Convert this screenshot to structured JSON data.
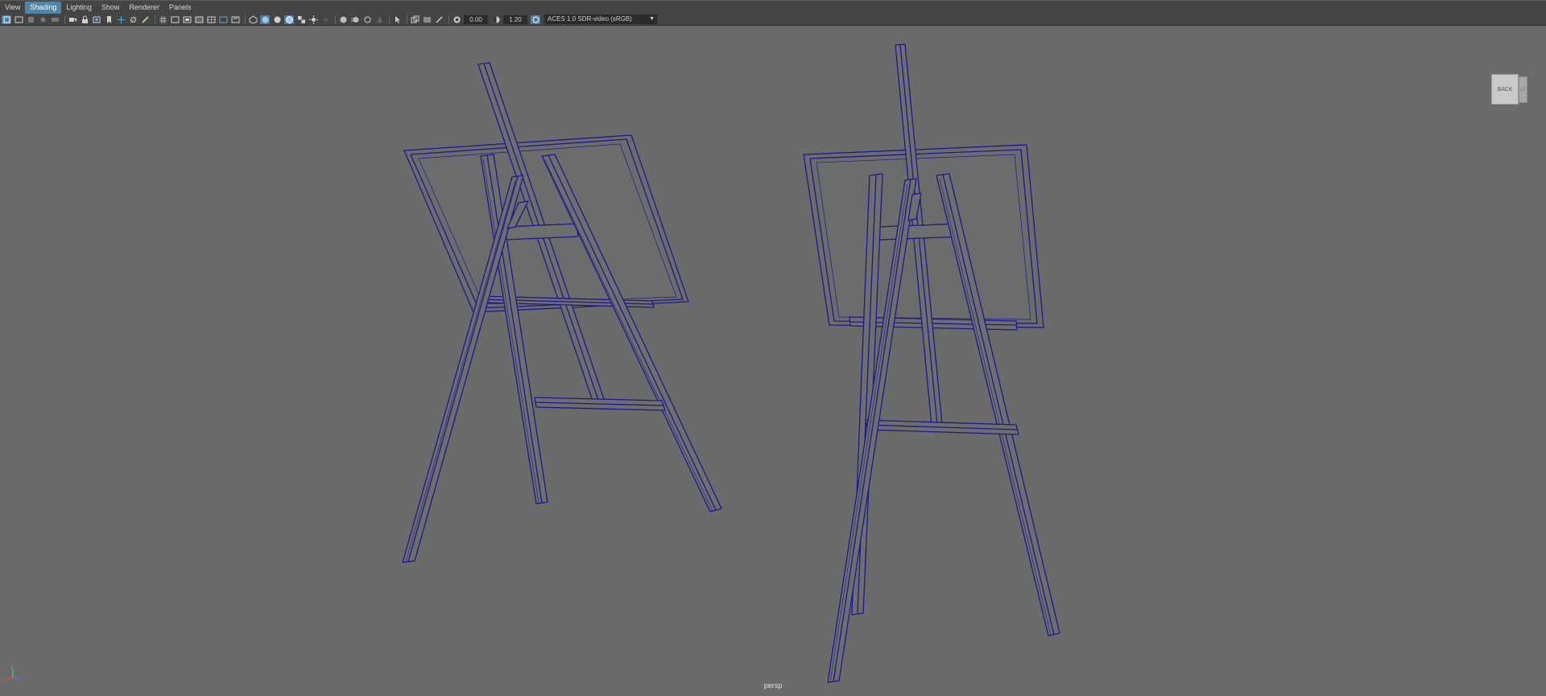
{
  "menus": [
    "View",
    "Shading",
    "Lighting",
    "Show",
    "Renderer",
    "Panels"
  ],
  "active_menu": "Shading",
  "toolbar": {
    "exposure": "0.00",
    "gamma": "1.20",
    "color_management": "ACES 1.0 SDR-video (sRGB)"
  },
  "viewcube": {
    "face_label": "BACK",
    "side_label": "LF"
  },
  "camera_label": "persp",
  "axis": {
    "x": "x",
    "y": "y",
    "z": "z"
  },
  "colors": {
    "wireframe": "#1a1a8c",
    "surface": "#6e6e6e",
    "background": "#6b6b6b"
  }
}
